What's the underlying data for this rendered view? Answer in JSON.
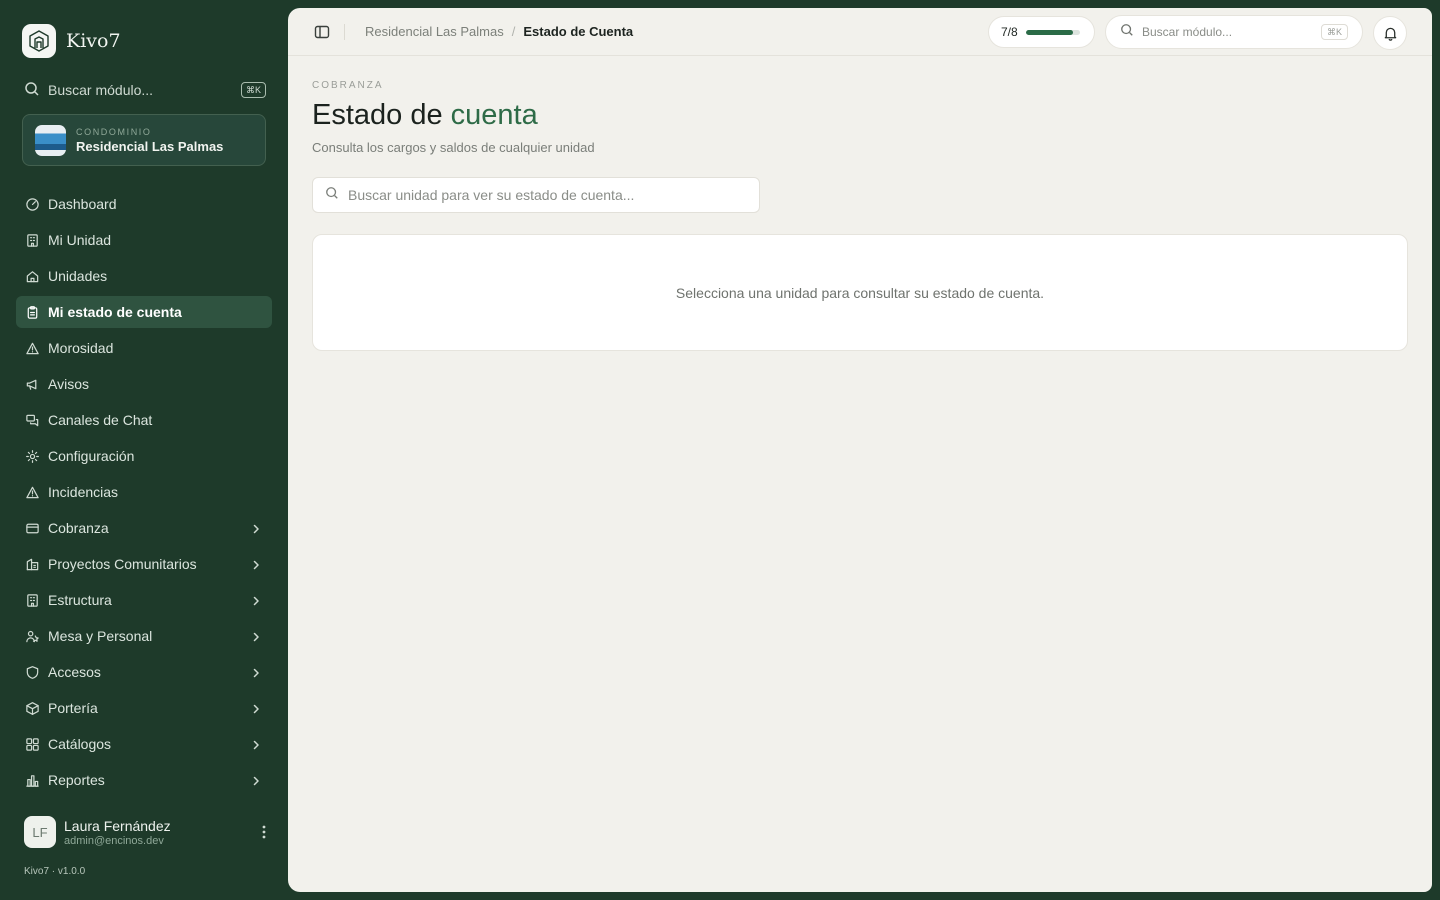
{
  "brand": {
    "name": "Kivo7"
  },
  "sidebar": {
    "search_label": "Buscar módulo...",
    "search_shortcut": "⌘K",
    "condo": {
      "kicker": "CONDOMINIO",
      "name": "Residencial Las Palmas"
    },
    "items": [
      {
        "label": "Dashboard",
        "icon": "gauge-icon",
        "active": false,
        "expandable": false
      },
      {
        "label": "Mi Unidad",
        "icon": "building-icon",
        "active": false,
        "expandable": false
      },
      {
        "label": "Unidades",
        "icon": "home-icon",
        "active": false,
        "expandable": false
      },
      {
        "label": "Mi estado de cuenta",
        "icon": "clipboard-icon",
        "active": true,
        "expandable": false
      },
      {
        "label": "Morosidad",
        "icon": "warning-icon",
        "active": false,
        "expandable": false
      },
      {
        "label": "Avisos",
        "icon": "megaphone-icon",
        "active": false,
        "expandable": false
      },
      {
        "label": "Canales de Chat",
        "icon": "chat-icon",
        "active": false,
        "expandable": false
      },
      {
        "label": "Configuración",
        "icon": "gear-icon",
        "active": false,
        "expandable": false
      },
      {
        "label": "Incidencias",
        "icon": "warning-icon",
        "active": false,
        "expandable": false
      },
      {
        "label": "Cobranza",
        "icon": "card-icon",
        "active": false,
        "expandable": true
      },
      {
        "label": "Proyectos Comunitarios",
        "icon": "project-icon",
        "active": false,
        "expandable": true
      },
      {
        "label": "Estructura",
        "icon": "building-icon",
        "active": false,
        "expandable": true
      },
      {
        "label": "Mesa y Personal",
        "icon": "people-icon",
        "active": false,
        "expandable": true
      },
      {
        "label": "Accesos",
        "icon": "shield-icon",
        "active": false,
        "expandable": true
      },
      {
        "label": "Portería",
        "icon": "box-icon",
        "active": false,
        "expandable": true
      },
      {
        "label": "Catálogos",
        "icon": "grid-icon",
        "active": false,
        "expandable": true
      },
      {
        "label": "Reportes",
        "icon": "bar-chart-icon",
        "active": false,
        "expandable": true
      }
    ],
    "user": {
      "initials": "LF",
      "name": "Laura Fernández",
      "email": "admin@encinos.dev"
    },
    "version": "Kivo7 · v1.0.0"
  },
  "topbar": {
    "breadcrumb": {
      "parent": "Residencial Las Palmas",
      "separator": "/",
      "current": "Estado de Cuenta"
    },
    "progress": {
      "label": "7/8",
      "fraction": 0.875
    },
    "search_placeholder": "Buscar módulo...",
    "search_shortcut": "⌘K"
  },
  "page": {
    "kicker": "COBRANZA",
    "title_main": "Estado de ",
    "title_accent": "cuenta",
    "subtitle": "Consulta los cargos y saldos de cualquier unidad",
    "unit_search_placeholder": "Buscar unidad para ver su estado de cuenta...",
    "empty_message": "Selecciona una unidad para consultar su estado de cuenta."
  },
  "colors": {
    "sidebar_bg": "#1e3a2a",
    "accent": "#2e6b47",
    "panel_bg": "#f2f1ec"
  }
}
